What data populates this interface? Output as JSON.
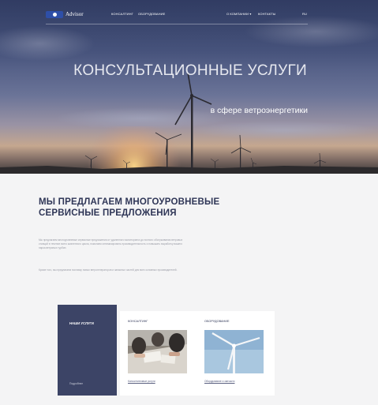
{
  "header": {
    "logo_text": "Advisor",
    "nav": [
      "КОНСАЛТИНГ",
      "ОБОРУДОВАНИЕ",
      "О КОМПАНИИ",
      "КОНТАКТЫ",
      "RU"
    ]
  },
  "hero": {
    "title": "КОНСУЛЬТАЦИОННЫЕ УСЛУГИ",
    "subtitle": "в сфере ветроэнергетики"
  },
  "services": {
    "title": "МЫ ПРЕДЛАГАЕМ МНОГОУРОВНЕВЫЕ СЕРВИСНЫЕ ПРЕДЛОЖЕНИЯ",
    "paragraph1": "Мы предлагаем многоуровневые сервисные предложения от удаленного мониторинга до полного обслуживания ветровых станций в течение всего жизненного цикла, помогаем оптимизировать производительность и повышать выработку вашего парка ветряных турбин.",
    "paragraph2": "Кроме того, мы предлагаем поставку новых ветрогенераторов и запасных частей для всех основных производителей.",
    "cards": {
      "dark_title": "НАШИ УСЛУГИ",
      "dark_link": "Подробнее",
      "items": [
        {
          "title": "КОНСАЛТИНГ",
          "link": "Консалтинговые услуги"
        },
        {
          "title": "ОБОРУДОВАНИЕ",
          "link": "Оборудование и запчасти"
        }
      ]
    }
  },
  "colors": {
    "primary_dark": "#2f3657",
    "card_dark": "#3c4466",
    "background": "#f4f4f5"
  }
}
